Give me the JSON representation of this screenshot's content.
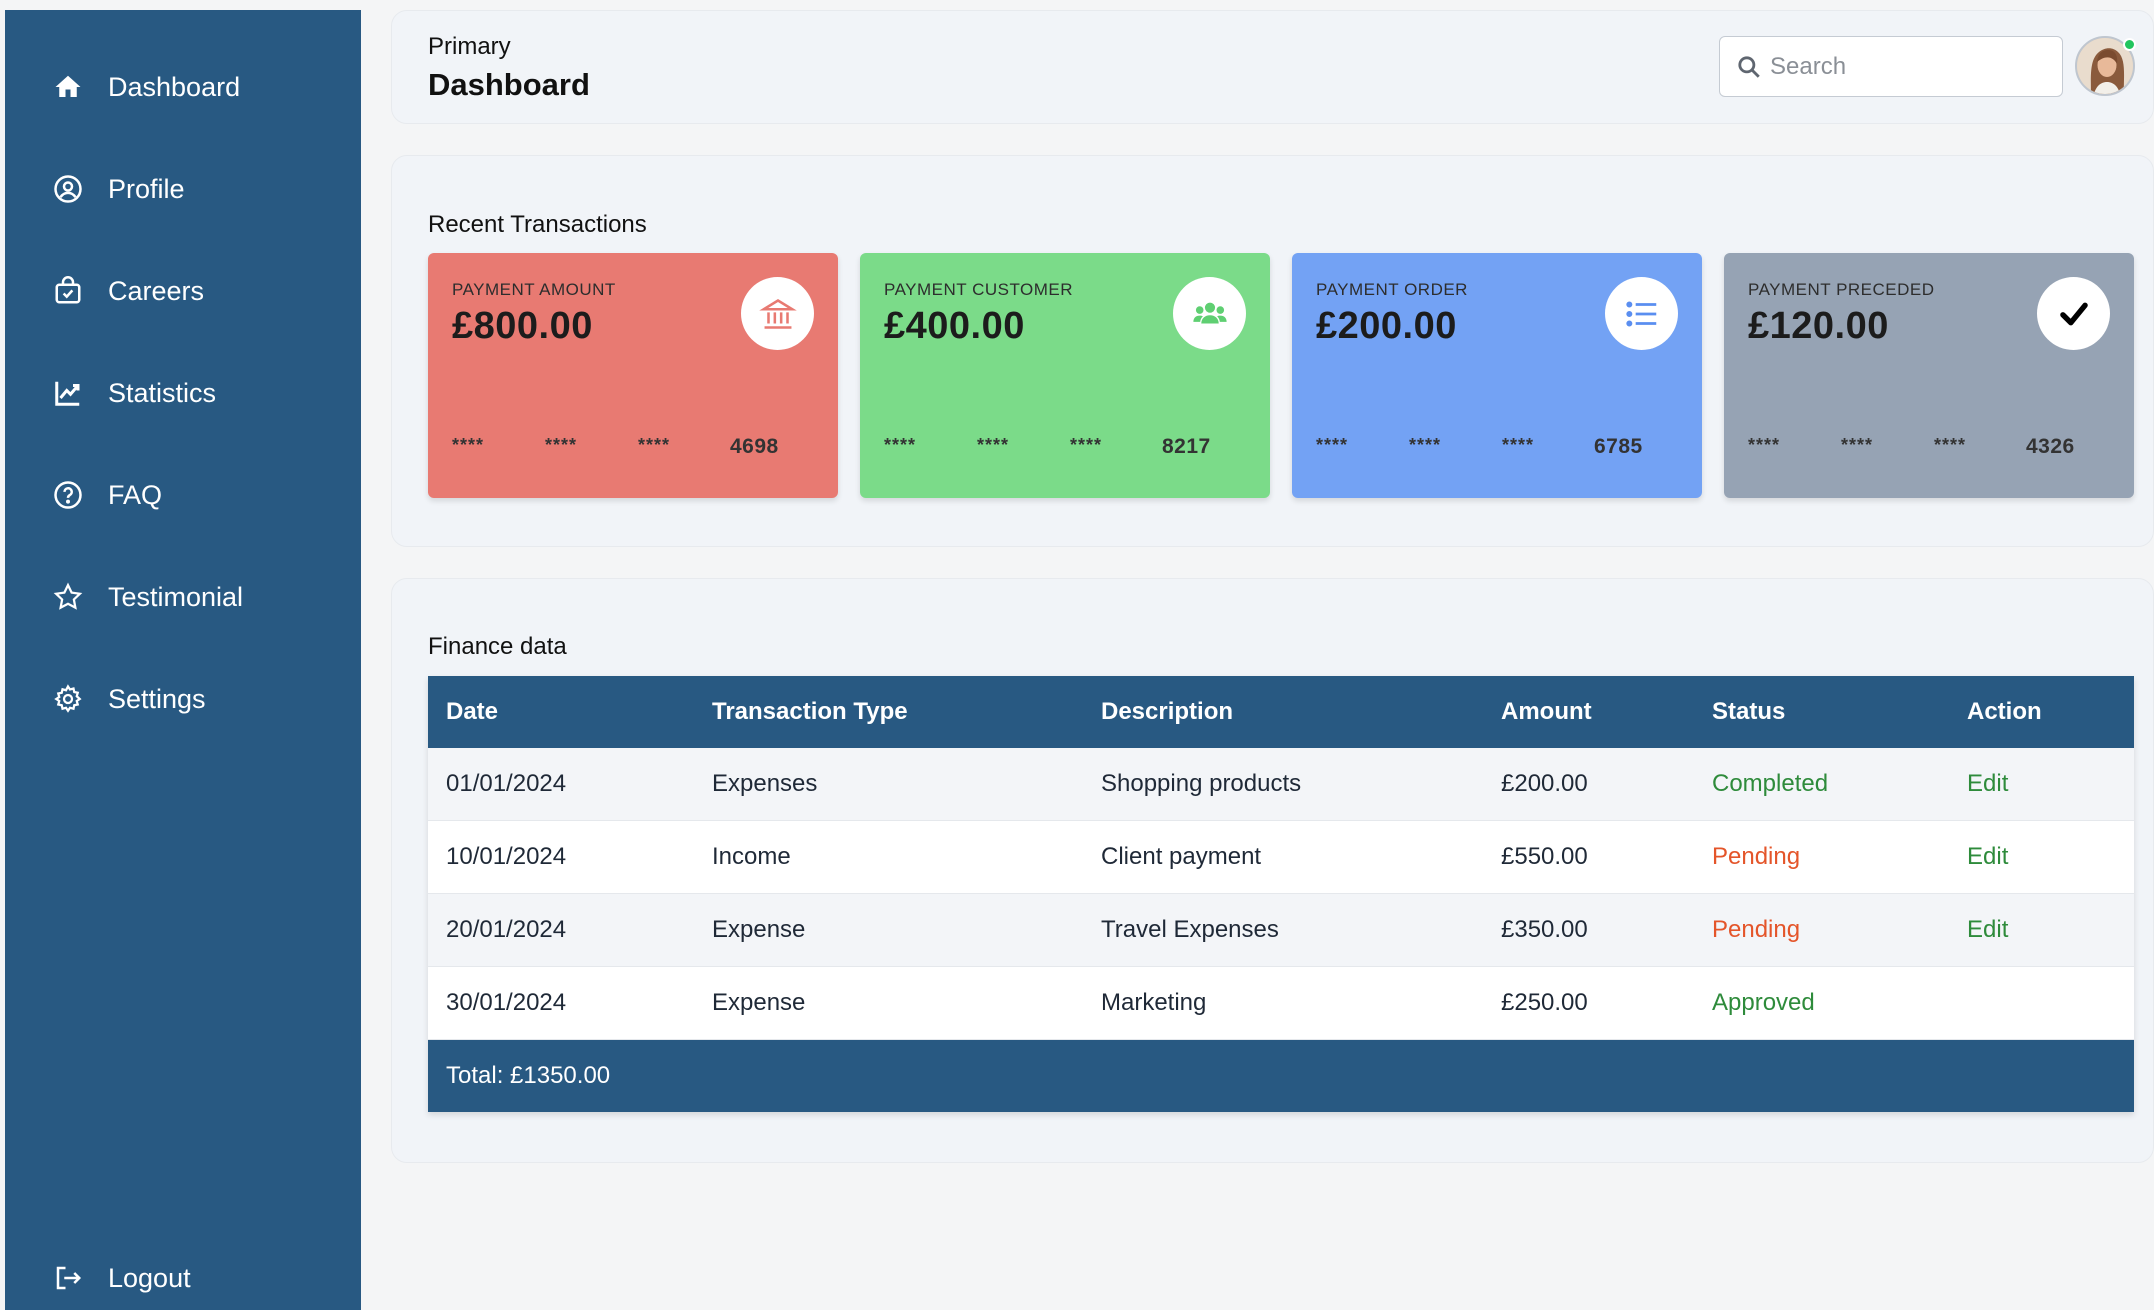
{
  "sidebar": {
    "items": [
      {
        "label": "Dashboard",
        "icon": "home-icon"
      },
      {
        "label": "Profile",
        "icon": "user-circle-icon"
      },
      {
        "label": "Careers",
        "icon": "briefcase-icon"
      },
      {
        "label": "Statistics",
        "icon": "chart-line-icon"
      },
      {
        "label": "FAQ",
        "icon": "question-circle-icon"
      },
      {
        "label": "Testimonial",
        "icon": "star-icon"
      },
      {
        "label": "Settings",
        "icon": "gear-icon"
      }
    ],
    "logout": {
      "label": "Logout",
      "icon": "logout-icon"
    }
  },
  "header": {
    "subtitle": "Primary",
    "title": "Dashboard",
    "search_placeholder": "Search"
  },
  "transactions": {
    "title": "Recent Transactions",
    "cards": [
      {
        "caption": "PAYMENT AMOUNT",
        "amount": "£800.00",
        "mask": "****",
        "last4": "4698",
        "color": "#e87a72",
        "icon": "bank-icon",
        "icon_color": "#e87a72"
      },
      {
        "caption": "PAYMENT CUSTOMER",
        "amount": "£400.00",
        "mask": "****",
        "last4": "8217",
        "color": "#7bdb89",
        "icon": "users-icon",
        "icon_color": "#5fcf72"
      },
      {
        "caption": "PAYMENT ORDER",
        "amount": "£200.00",
        "mask": "****",
        "last4": "6785",
        "color": "#73a2f4",
        "icon": "list-icon",
        "icon_color": "#5a8ef0"
      },
      {
        "caption": "PAYMENT PRECEDED",
        "amount": "£120.00",
        "mask": "****",
        "last4": "4326",
        "color": "#96a3b4",
        "icon": "check-icon",
        "icon_color": "#000000"
      }
    ]
  },
  "finance": {
    "title": "Finance data",
    "columns": [
      "Date",
      "Transaction Type",
      "Description",
      "Amount",
      "Status",
      "Action"
    ],
    "rows": [
      {
        "date": "01/01/2024",
        "type": "Expenses",
        "description": "Shopping products",
        "amount": "£200.00",
        "status": "Completed",
        "status_color": "#2e8b3b",
        "action": "Edit"
      },
      {
        "date": "10/01/2024",
        "type": "Income",
        "description": "Client payment",
        "amount": "£550.00",
        "status": "Pending",
        "status_color": "#e4552a",
        "action": "Edit"
      },
      {
        "date": "20/01/2024",
        "type": "Expense",
        "description": "Travel Expenses",
        "amount": "£350.00",
        "status": "Pending",
        "status_color": "#e4552a",
        "action": "Edit"
      },
      {
        "date": "30/01/2024",
        "type": "Expense",
        "description": "Marketing",
        "amount": "£250.00",
        "status": "Approved",
        "status_color": "#2e8b3b",
        "action": ""
      }
    ],
    "total": "Total: £1350.00"
  },
  "colors": {
    "sidebar": "#285982",
    "table_header": "#285982",
    "status_green": "#2e8b3b",
    "status_orange": "#e4552a"
  }
}
